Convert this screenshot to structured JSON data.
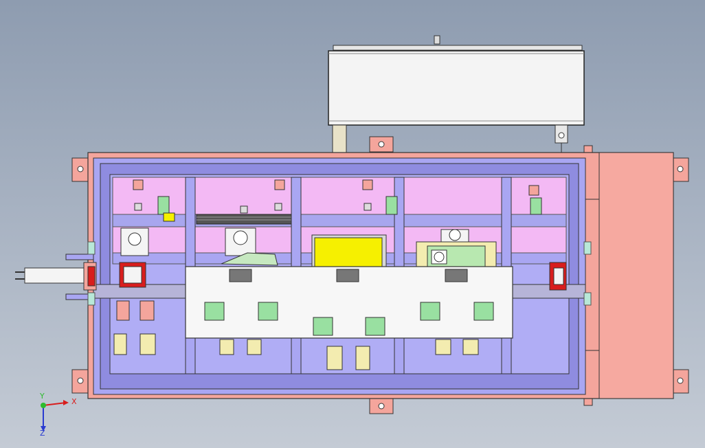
{
  "triad": {
    "x_label": "X",
    "y_label": "Y",
    "z_label": "Z"
  },
  "colors": {
    "frame_salmon": "#f4a59c",
    "panel_lavender": "#a9a6f2",
    "panel_pink": "#f3b9f4",
    "plate_white": "#f7f7f7",
    "motor_green": "#99e0a1",
    "yellow_block": "#f6f000",
    "cylinder_red": "#d81d1d",
    "housing_white": "#f4f4f4"
  },
  "components": {
    "housing_label": "top-housing",
    "plate_label": "mounting-plate"
  }
}
